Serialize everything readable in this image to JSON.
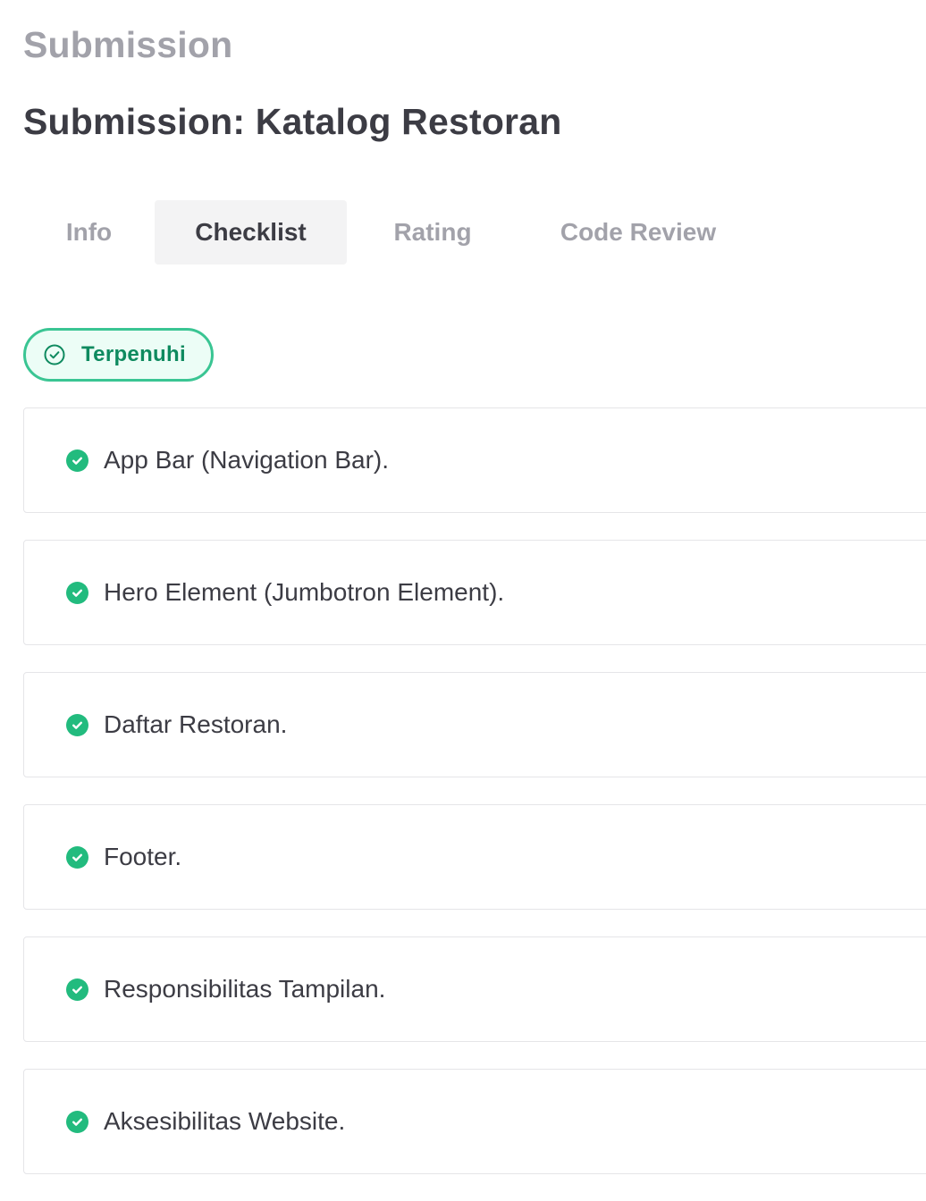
{
  "header": {
    "section_title": "Submission",
    "page_title": "Submission: Katalog Restoran"
  },
  "tabs": [
    {
      "label": "Info",
      "active": false
    },
    {
      "label": "Checklist",
      "active": true
    },
    {
      "label": "Rating",
      "active": false
    },
    {
      "label": "Code Review",
      "active": false
    }
  ],
  "status": {
    "label": "Terpenuhi",
    "icon": "circle-check-outline-icon"
  },
  "checklist": {
    "item_icon": "check-circle-filled-icon",
    "items": [
      {
        "label": "App Bar (Navigation Bar)."
      },
      {
        "label": "Hero Element (Jumbotron Element)."
      },
      {
        "label": "Daftar Restoran."
      },
      {
        "label": "Footer."
      },
      {
        "label": "Responsibilitas Tampilan."
      },
      {
        "label": "Aksesibilitas Website."
      }
    ]
  },
  "colors": {
    "accent_green": "#22bb7e",
    "badge_border": "#3ac593",
    "badge_background": "#ecfdf6",
    "badge_text": "#0e8a5f",
    "muted_text": "#a2a2aa",
    "primary_text": "#3c3c44",
    "active_tab_background": "#f3f3f4"
  }
}
